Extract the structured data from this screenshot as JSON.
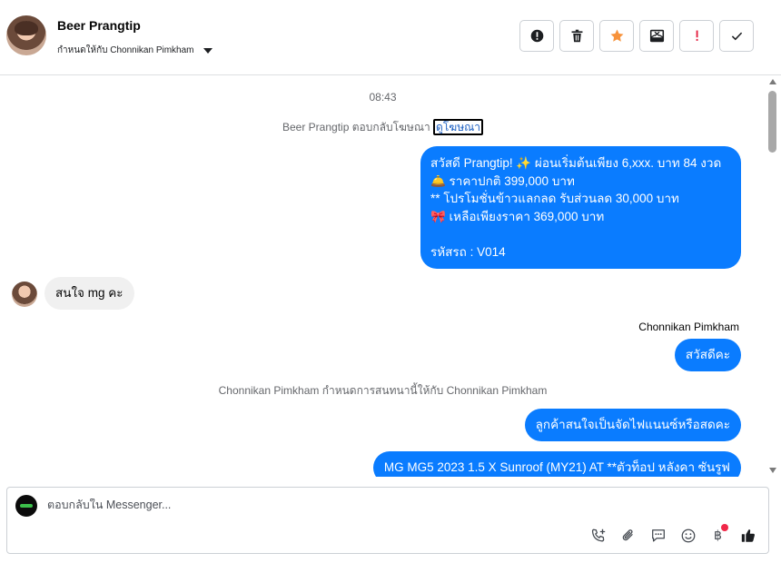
{
  "header": {
    "contact_name": "Beer Prangtip",
    "assigned_label": "กำหนดให้กับ Chonnikan Pimkham"
  },
  "actions": [
    {
      "name": "spam",
      "icon": "alert-circle-icon"
    },
    {
      "name": "delete",
      "icon": "trash-icon"
    },
    {
      "name": "star",
      "icon": "star-icon",
      "color": "#f7923b"
    },
    {
      "name": "mark-unread",
      "icon": "envelope-x-icon"
    },
    {
      "name": "important",
      "icon": "exclamation-icon",
      "color": "#e41e3f"
    },
    {
      "name": "done",
      "icon": "checkmark-icon"
    }
  ],
  "thread": {
    "timestamp": "08:43",
    "ad_reply_text": "Beer Prangtip ตอบกลับโฆษณา",
    "ad_link_text": "ดูโฆษณา",
    "promo_message": {
      "lines": [
        "สวัสดี Prangtip! ✨  ผ่อนเริ่มต้นเพียง 6,xxx. บาท 84 งวด",
        "🛎️ ราคาปกติ 399,000 บาท",
        "** โปรโมชั่นข้าวแลกลด รับส่วนลด 30,000 บาท",
        "🎀  เหลือเพียงราคา 369,000 บาท",
        "",
        "รหัสรถ : V014"
      ]
    },
    "incoming_message": "สนใจ mg คะ",
    "sender_name": "Chonnikan Pimkham",
    "reply_hello": "สวัสดีคะ",
    "assignment_note": "Chonnikan Pimkham กำหนดการสนทนานี้ให้กับ Chonnikan Pimkham",
    "question": "ลูกค้าสนใจเป็นจัดไฟแนนซ์หรือสดคะ",
    "car_message": "MG MG5 2023 1.5 X Sunroof (MY21) AT **ตัวท็อป หลังคา ซันรูฟ"
  },
  "composer": {
    "placeholder": "ตอบกลับใน Messenger...",
    "tools": [
      {
        "name": "call",
        "icon": "phone-plus-icon"
      },
      {
        "name": "attach",
        "icon": "paperclip-icon"
      },
      {
        "name": "saved-replies",
        "icon": "chat-bubble-icon"
      },
      {
        "name": "emoji",
        "icon": "smiley-icon"
      },
      {
        "name": "payment",
        "icon": "baht-icon",
        "glyph": "฿"
      },
      {
        "name": "like",
        "icon": "thumbs-up-icon"
      }
    ],
    "accent_color": "#0a7cff"
  }
}
